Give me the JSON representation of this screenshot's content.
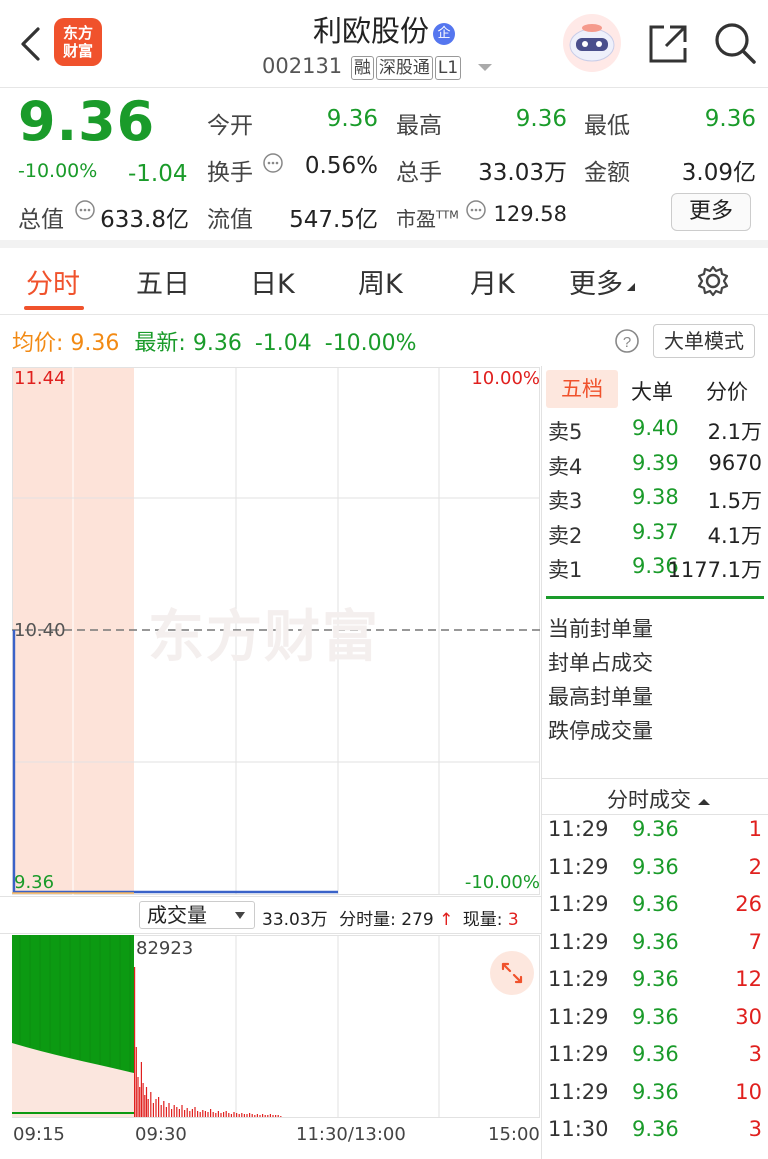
{
  "header": {
    "back_icon": "chevron-left-icon",
    "logo_line1": "东方",
    "logo_line2": "财富",
    "stock_name": "利欧股份",
    "badge": "企",
    "code": "002131",
    "tags": [
      "融",
      "深股通",
      "L1"
    ],
    "share_icon": "share-icon",
    "search_icon": "search-icon"
  },
  "quote": {
    "price": "9.36",
    "change_pct": "-10.00%",
    "change": "-1.04",
    "fields": {
      "open_label": "今开",
      "open": "9.36",
      "high_label": "最高",
      "high": "9.36",
      "low_label": "最低",
      "low": "9.36",
      "turnover_label": "换手",
      "turnover": "0.56%",
      "volume_label": "总手",
      "volume": "33.03万",
      "amount_label": "金额",
      "amount": "3.09亿",
      "mktcap_label": "总值",
      "mktcap": "633.8亿",
      "float_label": "流值",
      "float": "547.5亿",
      "pe_label": "市盈",
      "pe_sup": "TTM",
      "pe": "129.58"
    },
    "more_label": "更多"
  },
  "tabs": [
    "分时",
    "五日",
    "日K",
    "周K",
    "月K",
    "更多"
  ],
  "active_tab": "分时",
  "info": {
    "avg_label": "均价:",
    "avg": "9.36",
    "latest_label": "最新:",
    "latest": "9.36",
    "change": "-1.04",
    "change_pct": "-10.00%",
    "mode_label": "大单模式"
  },
  "chart": {
    "price_high": "11.44",
    "price_mid": "10.40",
    "price_low": "9.36",
    "pct_high": "10.00%",
    "pct_low": "-10.00%",
    "watermark": "东方财富",
    "volume_selector": "成交量",
    "volume_total": "33.03万",
    "tick_vol_label": "分时量:",
    "tick_vol": "279",
    "now_vol_label": "现量:",
    "now_vol": "3",
    "vol_max": "82923",
    "times": [
      "09:15",
      "09:30",
      "11:30/13:00",
      "15:00"
    ],
    "colors": {
      "up": "#e0201e",
      "down": "#1a9b2a",
      "price_line": "#3a62c8",
      "auction_bg": "#fde3d9"
    }
  },
  "order_book": {
    "tabs": [
      "五档",
      "大单",
      "分价"
    ],
    "asks": [
      {
        "label": "卖5",
        "price": "9.40",
        "vol": "2.1万"
      },
      {
        "label": "卖4",
        "price": "9.39",
        "vol": "9670"
      },
      {
        "label": "卖3",
        "price": "9.38",
        "vol": "1.5万"
      },
      {
        "label": "卖2",
        "price": "9.37",
        "vol": "4.1万"
      },
      {
        "label": "卖1",
        "price": "9.36",
        "vol": "1177.1万"
      }
    ],
    "limit_info": [
      "当前封单量",
      "封单占成交",
      "最高封单量",
      "跌停成交量"
    ]
  },
  "ticks": {
    "title": "分时成交",
    "rows": [
      {
        "time": "11:29",
        "price": "9.36",
        "vol": "1"
      },
      {
        "time": "11:29",
        "price": "9.36",
        "vol": "2"
      },
      {
        "time": "11:29",
        "price": "9.36",
        "vol": "26"
      },
      {
        "time": "11:29",
        "price": "9.36",
        "vol": "7"
      },
      {
        "time": "11:29",
        "price": "9.36",
        "vol": "12"
      },
      {
        "time": "11:29",
        "price": "9.36",
        "vol": "30"
      },
      {
        "time": "11:29",
        "price": "9.36",
        "vol": "3"
      },
      {
        "time": "11:29",
        "price": "9.36",
        "vol": "10"
      },
      {
        "time": "11:30",
        "price": "9.36",
        "vol": "3"
      }
    ]
  }
}
